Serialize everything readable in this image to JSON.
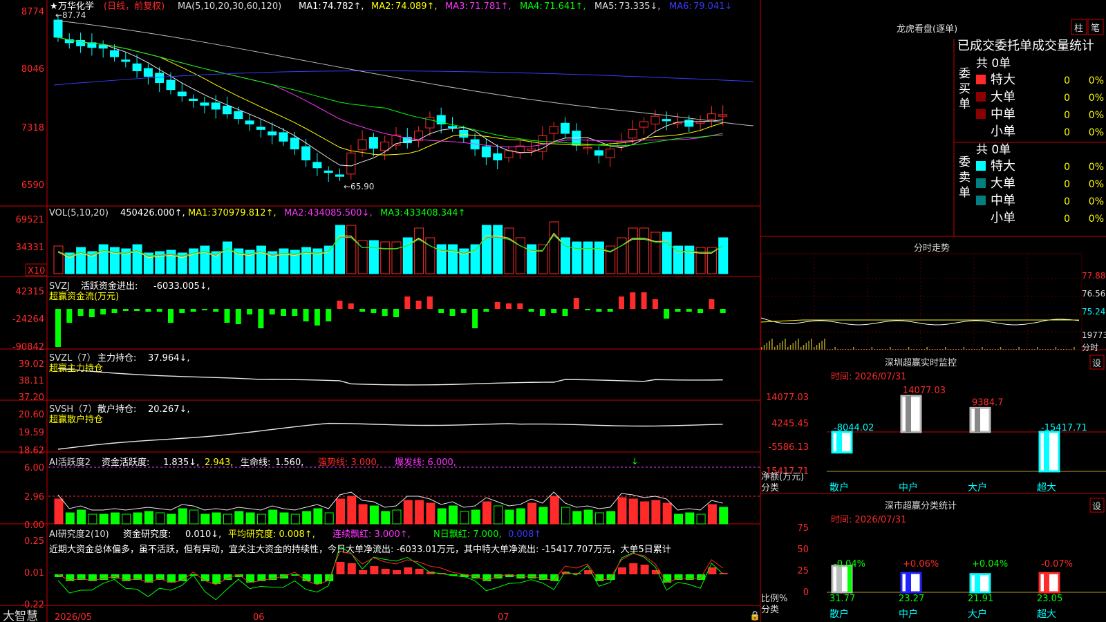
{
  "colors": {
    "up": "#ff2a2a",
    "down": "#00ffff",
    "border": "#cc0000",
    "white": "#e8e8e8",
    "yellow": "#ffff00",
    "magenta": "#ff33ff",
    "green": "#00ff00",
    "blue": "#3a3aff",
    "gray": "#c0c0c0",
    "olive": "#b0a020",
    "teal": "#008080",
    "darkred": "#8b0000"
  },
  "main": {
    "star": "★",
    "title": "万华化学",
    "mode": "(日线，前复权)",
    "ma_header": "MA(5,10,20,30,60,120)",
    "ma": [
      {
        "label": "MA1:",
        "value": "74.782↑,"
      },
      {
        "label": "MA2:",
        "value": "74.089↑,"
      },
      {
        "label": "MA3:",
        "value": "71.781↑,"
      },
      {
        "label": "MA4:",
        "value": "71.641↑,"
      },
      {
        "label": "MA5:",
        "value": "73.335↓,"
      },
      {
        "label": "MA6:",
        "value": "79.041↓"
      }
    ],
    "y_labels": [
      "8774",
      "8046",
      "7318",
      "6590"
    ],
    "high_note": "←87.74",
    "low_note": "←65.90"
  },
  "vol": {
    "header": "VOL(5,10,20)",
    "value": "450426.000↑,",
    "ma": [
      {
        "label": "MA1:",
        "value": "370979.812↑,"
      },
      {
        "label": "MA2:",
        "value": "434085.500↓,"
      },
      {
        "label": "MA3:",
        "value": "433408.344↑"
      }
    ],
    "y_labels": [
      "69521",
      "34331"
    ],
    "unit": "X10"
  },
  "svzj": {
    "header": "SVZJ",
    "label": "活跃资金进出:",
    "value": "-6033.005↓,",
    "subtitle": "超赢资金流(万元)",
    "y_labels": [
      "42315",
      "-24264",
      "-90842"
    ]
  },
  "svzl": {
    "header": "SVZL（7）",
    "label": "主力持仓:",
    "value": "37.964↓,",
    "subtitle": "超赢主力持仓",
    "y_labels": [
      "39.02",
      "38.11",
      "37.20"
    ]
  },
  "svsh": {
    "header": "SVSH（7）",
    "label": "散户持仓:",
    "value": "20.267↓,",
    "subtitle": "超赢散户持仓",
    "y_labels": [
      "20.60",
      "19.59",
      "18.62"
    ]
  },
  "ai1": {
    "header": "AI活跃度2",
    "label": "资金活跃度:",
    "v1": "1.835↓,",
    "v2": "2.943,",
    "life_label": "生命线:",
    "life": "1.560,",
    "strong": "强势线: 3.000,",
    "burst": "爆发线: 6.000,",
    "y_labels": [
      "6.00",
      "2.96",
      "0.00"
    ]
  },
  "ai2": {
    "header": "AI研究度2(10)",
    "label": "资金研究度:",
    "v1": "0.010↓,",
    "avg": "平均研究度: 0.008↑,",
    "consec": "连续飘红: 3.000↑,",
    "nday": "N日飘红: 7.000,",
    "v5": "0.008↑",
    "comment": "近期大资金总体偏多，虽不活跃，但有异动，宜关注大资金的持续性，今日大单净流出: -6033.01万元，其中特大单净流出: -15417.707万元，大单5日累计",
    "y_labels": [
      "0.25",
      "0.01",
      "-0.22"
    ]
  },
  "footer": {
    "brand": "大智慧",
    "dates": [
      "2026/05",
      "06",
      "07"
    ]
  },
  "right": {
    "lhb_title": "龙虎看盘(逐单)",
    "tab1": "柱",
    "tab2": "笔",
    "stat_title": "已成交委托单成交量统计",
    "buy_side": "委买单",
    "sell_side": "委卖单",
    "buy_total": "共 0单",
    "sell_total": "共 0单",
    "rows": [
      {
        "name": "特大",
        "count": "0",
        "pct": "0%"
      },
      {
        "name": "大单",
        "count": "0",
        "pct": "0%"
      },
      {
        "name": "中单",
        "count": "0",
        "pct": "0%"
      },
      {
        "name": "小单",
        "count": "0",
        "pct": "0%"
      }
    ],
    "fs_title": "分时走势",
    "fs_y": [
      "77.88",
      "76.56",
      "75.24",
      "19773"
    ],
    "fs_unit": "分时",
    "monitor_title": "深圳超赢实时监控",
    "monitor_settings": "设",
    "monitor_time": "时间: 2026/07/31",
    "monitor_y": [
      "14077.03",
      "4245.45",
      "-5586.13",
      "-15417.71"
    ],
    "monitor_ylabel": "净额(万元)",
    "monitor_xlabel": "分类",
    "monitor_cats": [
      "散户",
      "中户",
      "大户",
      "超大"
    ],
    "monitor_vals": [
      "-8044.02",
      "14077.03",
      "9384.7",
      "-15417.71"
    ],
    "class_title": "深市超赢分类统计",
    "class_settings": "设",
    "class_time": "时间: 2026/07/31",
    "class_y": [
      "75",
      "50",
      "25",
      "0"
    ],
    "class_ylabel": "比例%",
    "class_xlabel": "分类",
    "class_cats": [
      "散户",
      "中户",
      "大户",
      "超大"
    ],
    "class_top": [
      "-0.04%",
      "+0.06%",
      "+0.04%",
      "-0.07%"
    ],
    "class_vals": [
      "31.77",
      "23.27",
      "21.91",
      "23.05"
    ]
  },
  "chart_data": {
    "type": "candlestick",
    "title": "万华化学 (日线，前复权)",
    "x_labels": [
      "2026/05",
      "06",
      "07"
    ],
    "ylim": [
      65.9,
      87.74
    ],
    "ohlc_close": [
      84.3,
      83.6,
      83.2,
      83.0,
      82.9,
      81.8,
      81.2,
      80.0,
      79.3,
      78.5,
      77.6,
      76.8,
      76.2,
      75.6,
      75.1,
      74.5,
      73.9,
      73.2,
      72.5,
      71.8,
      71.0,
      70.0,
      68.6,
      67.6,
      67.0,
      66.5,
      69.5,
      71.2,
      70.1,
      70.9,
      71.8,
      70.8,
      72.3,
      74.0,
      73.2,
      72.8,
      71.5,
      70.0,
      69.0,
      68.6,
      69.8,
      70.4,
      70.0,
      71.7,
      72.9,
      72.0,
      70.5,
      70.2,
      69.2,
      70.0,
      71.0,
      72.5,
      73.5,
      74.2,
      73.6,
      73.4,
      72.9,
      73.5,
      74.5,
      74.4
    ],
    "ma_latest": {
      "MA1": 74.782,
      "MA2": 74.089,
      "MA3": 71.781,
      "MA4": 71.641,
      "MA5": 73.335,
      "MA6": 79.041
    },
    "volume_latest": 450426.0,
    "svzj_latest": -6033.005,
    "svzl_latest": 37.964,
    "svsh_latest": 20.267,
    "activity_latest": 1.835,
    "research_latest": 0.01
  }
}
